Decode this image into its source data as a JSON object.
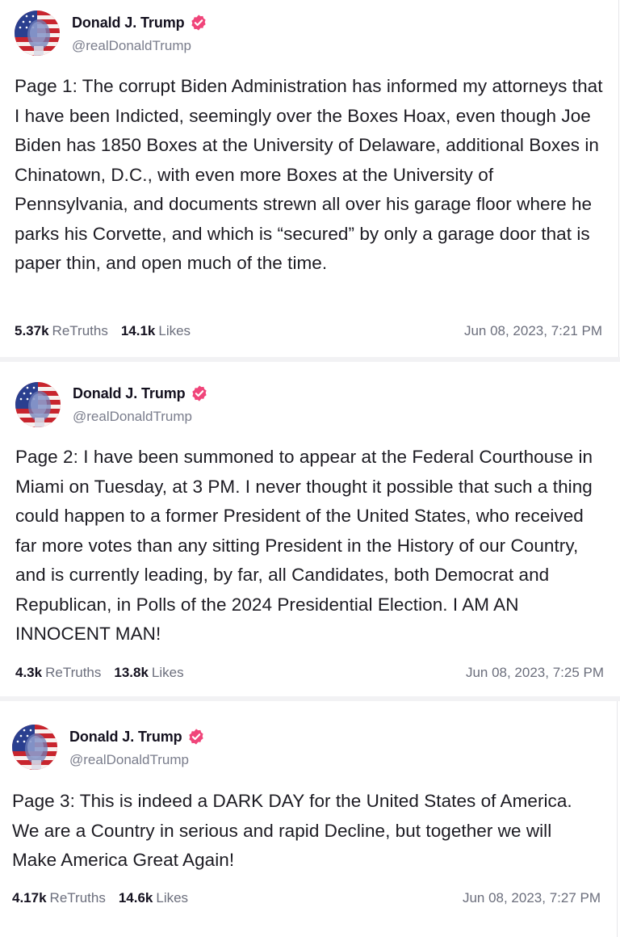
{
  "posts": [
    {
      "author": {
        "display_name": "Donald J. Trump",
        "handle": "@realDonaldTrump",
        "verified": true
      },
      "text": "Page 1: The corrupt Biden Administration has informed my attorneys that I have been Indicted, seemingly over the Boxes Hoax, even though Joe Biden has 1850 Boxes at the University of Delaware, additional Boxes in Chinatown, D.C., with even more Boxes at the University of Pennsylvania, and documents strewn all over his garage floor where he parks his Corvette, and which is “secured” by only a garage door that is paper thin, and open much of the time.",
      "retruths_count": "5.37k",
      "retruths_label": "ReTruths",
      "likes_count": "14.1k",
      "likes_label": "Likes",
      "timestamp": "Jun 08, 2023, 7:21 PM"
    },
    {
      "author": {
        "display_name": "Donald J. Trump",
        "handle": "@realDonaldTrump",
        "verified": true
      },
      "text": "Page 2: I have been summoned to appear at the Federal Courthouse in Miami on Tuesday, at 3 PM. I never thought it possible that such a thing could happen to a former President of the United States, who received far more votes than any sitting President in the History of our Country, and is currently leading, by far, all Candidates, both Democrat and Republican, in Polls of the 2024 Presidential Election. I AM AN INNOCENT MAN!",
      "retruths_count": "4.3k",
      "retruths_label": "ReTruths",
      "likes_count": "13.8k",
      "likes_label": "Likes",
      "timestamp": "Jun 08, 2023, 7:25 PM"
    },
    {
      "author": {
        "display_name": "Donald J. Trump",
        "handle": "@realDonaldTrump",
        "verified": true
      },
      "text": "Page 3: This is indeed a DARK DAY for the United States of America. We are a Country in serious and rapid Decline, but together we will Make America Great Again!",
      "retruths_count": "4.17k",
      "retruths_label": "ReTruths",
      "likes_count": "14.6k",
      "likes_label": "Likes",
      "timestamp": "Jun 08, 2023, 7:27 PM"
    }
  ],
  "icons": {
    "verified": "verified-badge-icon"
  },
  "colors": {
    "verified_badge": "#f0457a",
    "text_primary": "#14111f",
    "text_secondary": "#7a7d8c",
    "divider": "#f2f2f4"
  }
}
